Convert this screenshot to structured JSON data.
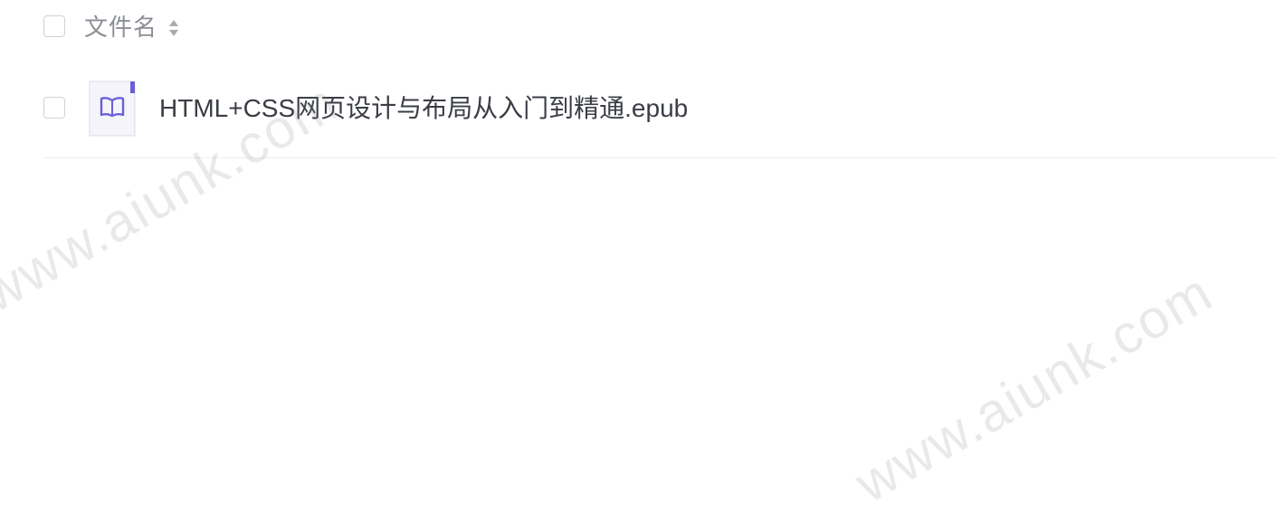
{
  "header": {
    "column_label": "文件名",
    "sort_icon": "sort-icon"
  },
  "files": [
    {
      "name": "HTML+CSS网页设计与布局从入门到精通.epub",
      "icon": "ebook-icon",
      "checked": false
    }
  ],
  "watermarks": [
    "www.aiunk.com",
    "www.aiunk.com"
  ],
  "colors": {
    "icon_accent": "#6b5fd8",
    "icon_bg": "#f5f4fb",
    "text": "#3a3d45",
    "header_text": "#8b8e95"
  }
}
